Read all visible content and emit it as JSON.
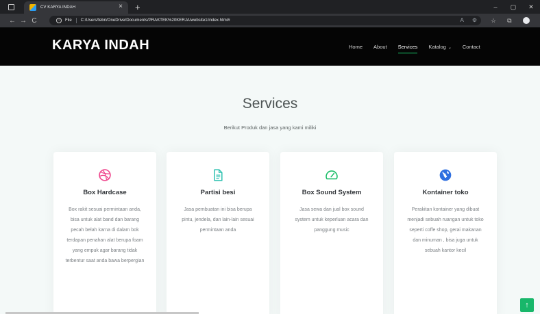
{
  "browser": {
    "tab_title": "CV KARYA INDAH",
    "tab_close": "×",
    "new_tab": "+",
    "window_controls": [
      "–",
      "▢",
      "✕"
    ],
    "nav_buttons": [
      "←",
      "→",
      "C"
    ],
    "info": "i",
    "file_label": "File",
    "url": "C:/Users/febri/OneDrive/Documents/PRAKTEK%20KERJA/website1/index.html#",
    "url_icons": [
      "A",
      "⚙"
    ],
    "toolbar_icons": [
      "☆",
      "⧉"
    ]
  },
  "site": {
    "brand": "KARYA INDAH",
    "menu": [
      {
        "label": "Home",
        "active": false
      },
      {
        "label": "About",
        "active": false
      },
      {
        "label": "Services",
        "active": true
      },
      {
        "label": "Katalog",
        "active": false,
        "dropdown": true,
        "caret": "⌄"
      },
      {
        "label": "Contact",
        "active": false
      }
    ]
  },
  "services": {
    "title": "Services",
    "subtitle": "Berikut Produk dan jasa yang kami miliki",
    "cards": [
      {
        "icon": "dribbble-icon",
        "color": "#ef4a8f",
        "title": "Box Hardcase",
        "text": "Box rakit sesuai permintaan anda, bisa untuk alat band dan barang pecah belah karna di dalam bok terdapan penahan alat berupa foam yang empuk agar barang tidak terbentur saat anda bawa berpergian"
      },
      {
        "icon": "file-icon",
        "color": "#2fc1b0",
        "title": "Partisi besi",
        "text": "Jasa pembuatan ini bisa berupa pintu, jendela, dan lain-lain sesuai permintaan anda"
      },
      {
        "icon": "speedometer-icon",
        "color": "#1fbf6b",
        "title": "Box Sound System",
        "text": "Jasa sewa dan jual box sound system untuk keperluan acara dan panggung music"
      },
      {
        "icon": "globe-icon",
        "color": "#2e6fe0",
        "title": "Kontainer toko",
        "text": "Perakitan kontainer yang dibuat menjadi sebuah ruangan untuk toko seperti coffe shop, gerai makanan dan minuman , bisa juga untuk sebuah kantor kecil"
      }
    ],
    "back_to_top": "↑"
  }
}
